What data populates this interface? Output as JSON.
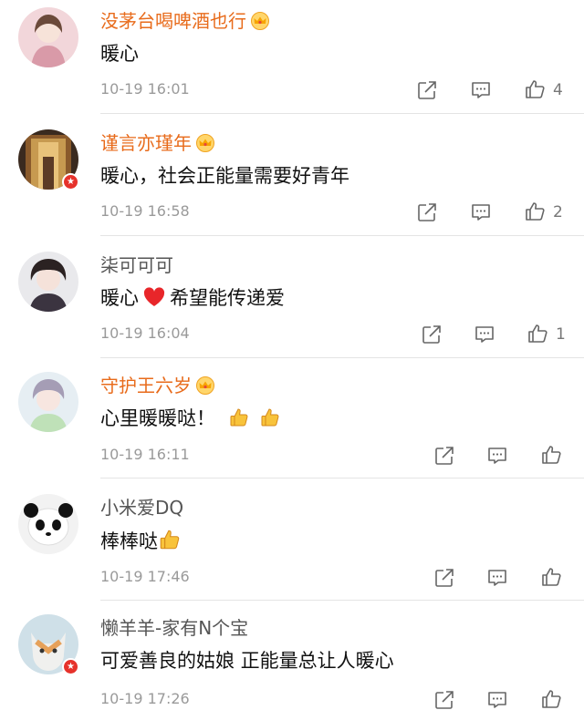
{
  "comments": [
    {
      "user": "没茅台喝啤酒也行",
      "vip": true,
      "verified": false,
      "text": "暖心",
      "time": "10-19 16:01",
      "likes": "4"
    },
    {
      "user": "谨言亦瑾年",
      "vip": true,
      "verified": true,
      "text": "暖心，社会正能量需要好青年",
      "time": "10-19 16:58",
      "likes": "2"
    },
    {
      "user": "柒可可可",
      "vip": false,
      "verified": false,
      "text_before": "暖心",
      "text_after": "希望能传递爱",
      "time": "10-19 16:04",
      "likes": "1"
    },
    {
      "user": "守护王六岁",
      "vip": true,
      "verified": false,
      "text": "心里暖暖哒！",
      "time": "10-19 16:11",
      "likes": ""
    },
    {
      "user": "小米爱DQ",
      "vip": false,
      "verified": false,
      "text": "棒棒哒",
      "time": "10-19 17:46",
      "likes": ""
    },
    {
      "user": "懒羊羊-家有N个宝",
      "vip": false,
      "verified": true,
      "text": "可爱善良的姑娘 正能量总让人暖心",
      "time": "10-19 17:26",
      "likes": ""
    }
  ],
  "icons": {
    "share": "share-icon",
    "comment": "comment-icon",
    "like": "thumbs-up-icon",
    "crown": "vip-crown-icon",
    "heart": "red-heart-emoji",
    "thumbs": "thumbs-up-emoji"
  },
  "colors": {
    "vip_name": "#e86b1b",
    "plain_name": "#555555",
    "time": "#9a9a9a",
    "verified": "#e6322b"
  }
}
